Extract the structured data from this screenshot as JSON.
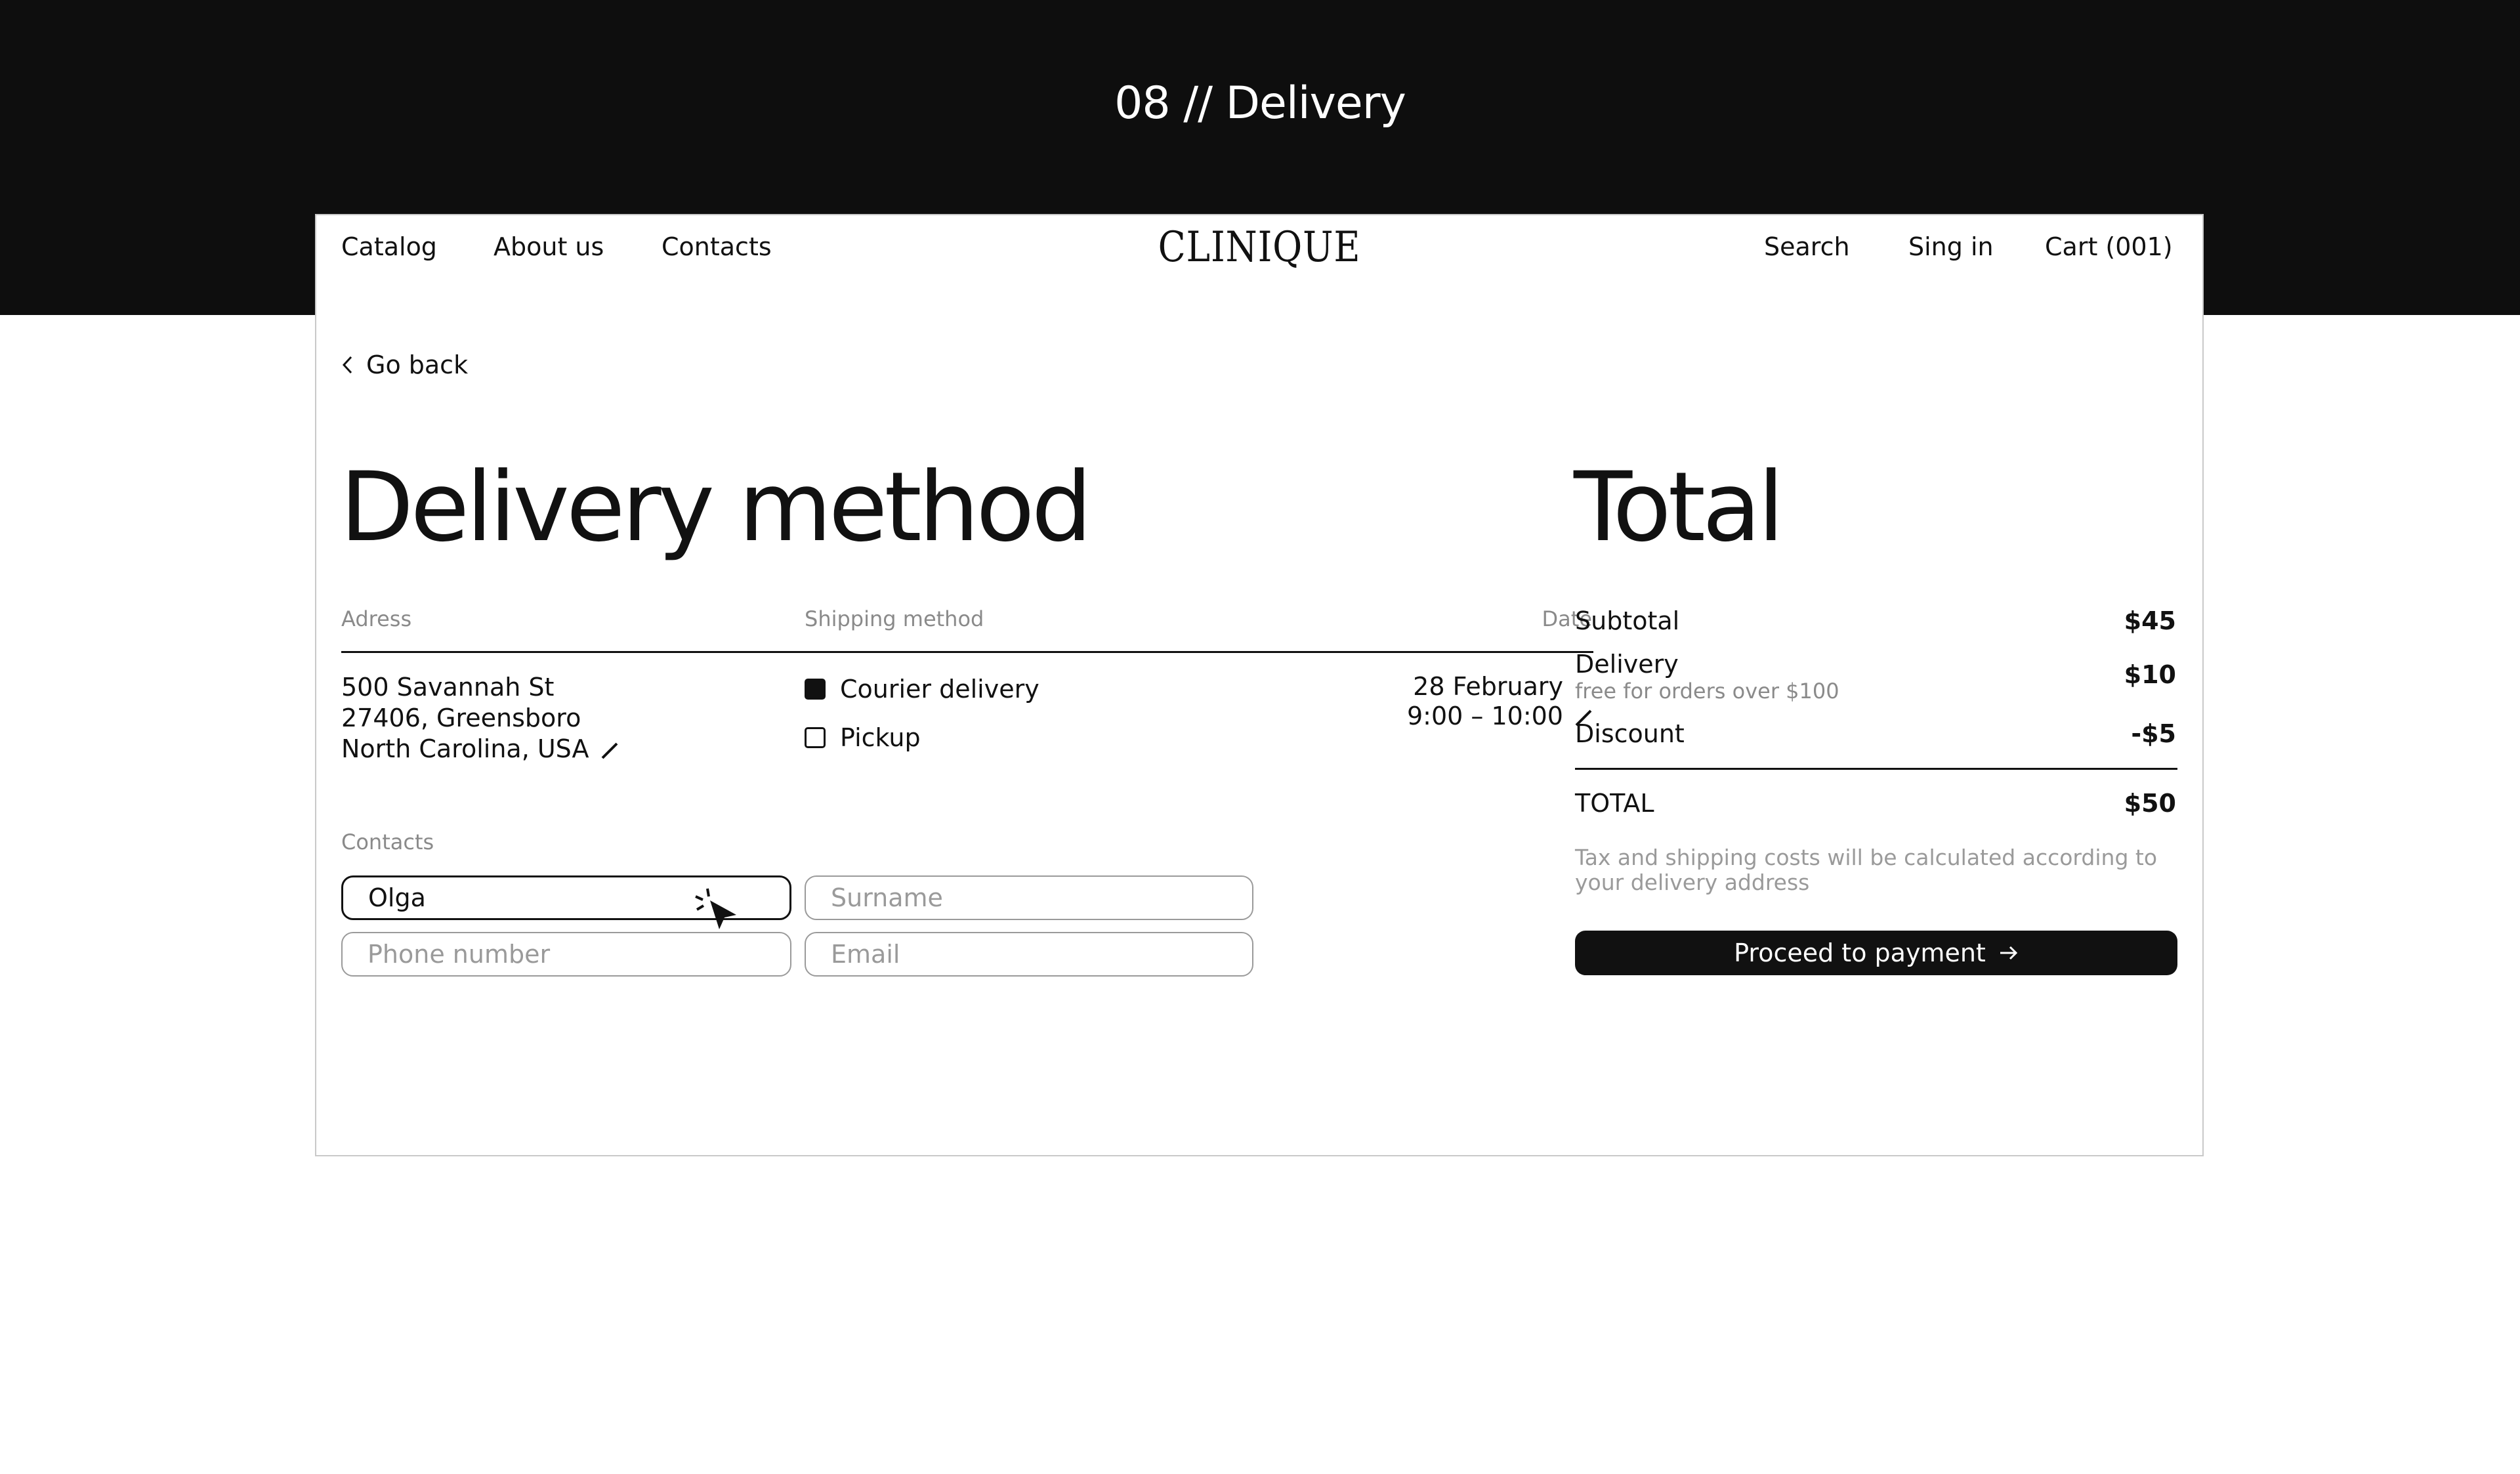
{
  "slide": {
    "title": "08 // Delivery"
  },
  "nav": {
    "left": [
      "Catalog",
      "About us",
      "Contacts"
    ],
    "logo": "CLINIQUE",
    "right": [
      "Search",
      "Sing in",
      "Cart (001)"
    ]
  },
  "back_label": "Go back",
  "delivery": {
    "heading": "Delivery method",
    "columns": {
      "address": "Adress",
      "shipping": "Shipping method",
      "date": "Date"
    },
    "address_lines": [
      "500 Savannah St",
      "27406, Greensboro",
      "North Carolina, USA"
    ],
    "shipping_options": [
      {
        "label": "Courier delivery",
        "checked": true
      },
      {
        "label": "Pickup",
        "checked": false
      }
    ],
    "date_lines": [
      "28 February",
      "9:00 – 10:00"
    ]
  },
  "contacts": {
    "label": "Contacts",
    "first_name_value": "Olga",
    "surname_placeholder": "Surname",
    "phone_placeholder": "Phone number",
    "email_placeholder": "Email"
  },
  "total": {
    "heading": "Total",
    "subtotal": {
      "label": "Subtotal",
      "value": "$45"
    },
    "delivery": {
      "label": "Delivery",
      "value": "$10",
      "note": "free for orders over $100"
    },
    "discount": {
      "label": "Discount",
      "value": "-$5"
    },
    "total": {
      "label": "TOTAL",
      "value": "$50"
    },
    "tax_note": "Tax and shipping costs will be calculated according to your delivery address",
    "button": "Proceed to payment"
  },
  "icons": {
    "back": "chevron-left-icon",
    "edit": "pencil-icon",
    "button_arrow": "arrow-right-icon",
    "cursor": "mouse-cursor-icon"
  },
  "colors": {
    "band": "#0e0e0e",
    "text": "#111111",
    "muted": "#8a8a8a",
    "field_border": "#9a9a9a"
  }
}
